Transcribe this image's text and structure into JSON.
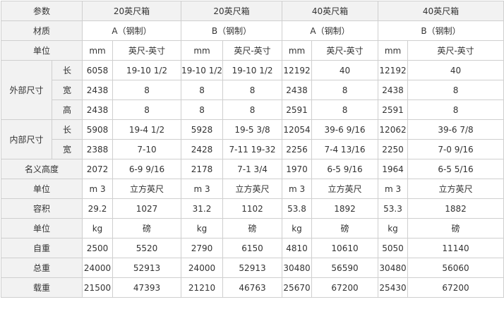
{
  "table": {
    "header": {
      "param": "参数",
      "c20": "20英尺箱",
      "c40": "40英尺箱"
    },
    "material": {
      "label": "材质",
      "a": "A（钢制）",
      "b": "B（钢制）"
    },
    "unit": {
      "label": "单位",
      "mm": "mm",
      "ftin": "英尺-英寸"
    },
    "external": {
      "group": "外部尺寸",
      "length": {
        "label": "长",
        "v": [
          "6058",
          "19-10 1/2",
          "19-10 1/2",
          "19-10 1/2",
          "12192",
          "40",
          "12192",
          "40"
        ]
      },
      "width": {
        "label": "宽",
        "v": [
          "2438",
          "8",
          "8",
          "8",
          "2438",
          "8",
          "2438",
          "8"
        ]
      },
      "height": {
        "label": "高",
        "v": [
          "2438",
          "8",
          "8",
          "8",
          "2591",
          "8",
          "2591",
          "8"
        ]
      }
    },
    "internal": {
      "group": "内部尺寸",
      "length": {
        "label": "长",
        "v": [
          "5908",
          "19-4 1/2",
          "5928",
          "19-5 3/8",
          "12054",
          "39-6 9/16",
          "12062",
          "39-6 7/8"
        ]
      },
      "width": {
        "label": "宽",
        "v": [
          "2388",
          "7-10",
          "2428",
          "7-11 19-32",
          "2256",
          "7-4 13/16",
          "2250",
          "7-0 9/16"
        ]
      }
    },
    "nominal_height": {
      "label": "名义高度",
      "v": [
        "2072",
        "6-9 9/16",
        "2178",
        "7-1 3/4",
        "1970",
        "6-5 9/16",
        "1964",
        "6-5 5/16"
      ]
    },
    "vol_unit": {
      "label": "单位",
      "v": [
        "m 3",
        "立方英尺",
        "m 3",
        "立方英尺",
        "m 3",
        "立方英尺",
        "m 3",
        "立方英尺"
      ]
    },
    "volume": {
      "label": "容积",
      "v": [
        "29.2",
        "1027",
        "31.2",
        "1102",
        "53.8",
        "1892",
        "53.3",
        "1882"
      ]
    },
    "wt_unit": {
      "label": "单位",
      "v": [
        "kg",
        "磅",
        "kg",
        "磅",
        "kg",
        "磅",
        "kg",
        "磅"
      ]
    },
    "tare": {
      "label": "自重",
      "v": [
        "2500",
        "5520",
        "2790",
        "6150",
        "4810",
        "10610",
        "5050",
        "11140"
      ]
    },
    "gross": {
      "label": "总重",
      "v": [
        "24000",
        "52913",
        "24000",
        "52913",
        "30480",
        "56590",
        "30480",
        "56060"
      ]
    },
    "payload": {
      "label": "载重",
      "v": [
        "21500",
        "47393",
        "21210",
        "46763",
        "25670",
        "67200",
        "25430",
        "67200"
      ]
    }
  }
}
